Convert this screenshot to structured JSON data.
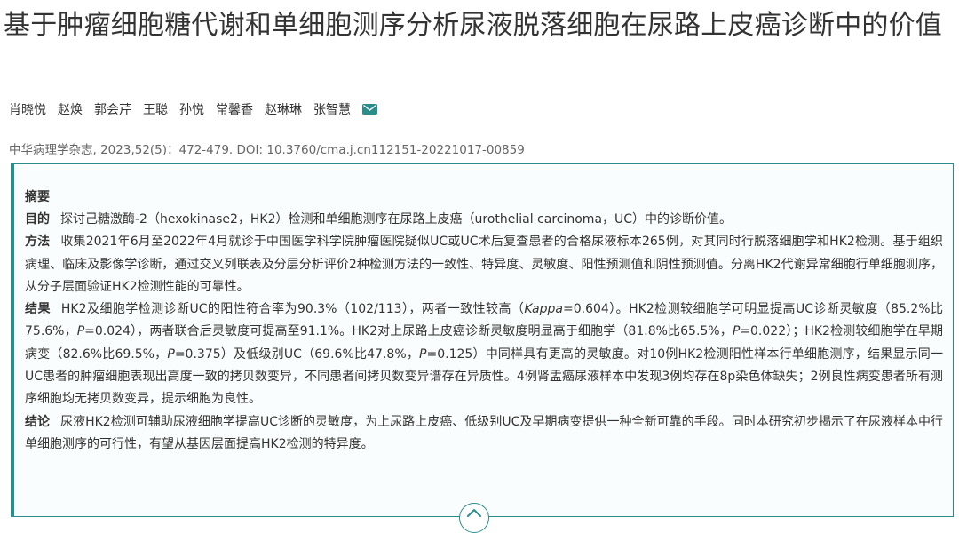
{
  "article": {
    "title": "基于肿瘤细胞糖代谢和单细胞测序分析尿液脱落细胞在尿路上皮癌诊断中的价值",
    "authors": [
      "肖晓悦",
      "赵焕",
      "郭会芹",
      "王聪",
      "孙悦",
      "常馨香",
      "赵琳琳",
      "张智慧"
    ],
    "journal_citation": "中华病理学杂志, 2023,52(5)：472-479. DOI: 10.3760/cma.j.cn112151-20221017-00859"
  },
  "abstract": {
    "heading": "摘要",
    "sections": [
      {
        "label": "目的",
        "parts": [
          {
            "text": "探讨己糖激酶-2（hexokinase2，HK2）检测和单细胞测序在尿路上皮癌（urothelial carcinoma，UC）中的诊断价值。",
            "italic": false
          }
        ]
      },
      {
        "label": "方法",
        "parts": [
          {
            "text": "收集2021年6月至2022年4月就诊于中国医学科学院肿瘤医院疑似UC或UC术后复查患者的合格尿液标本265例，对其同时行脱落细胞学和HK2检测。基于组织病理、临床及影像学诊断，通过交叉列联表及分层分析评价2种检测方法的一致性、特异度、灵敏度、阳性预测值和阴性预测值。分离HK2代谢异常细胞行单细胞测序，从分子层面验证HK2检测性能的可靠性。",
            "italic": false
          }
        ]
      },
      {
        "label": "结果",
        "parts": [
          {
            "text": "HK2及细胞学检测诊断UC的阳性符合率为90.3%（102/113），两者一致性较高（",
            "italic": false
          },
          {
            "text": "Kappa",
            "italic": true
          },
          {
            "text": "=0.604）。HK2检测较细胞学可明显提高UC诊断灵敏度（85.2%比75.6%，",
            "italic": false
          },
          {
            "text": "P",
            "italic": true
          },
          {
            "text": "=0.024），两者联合后灵敏度可提高至91.1%。HK2对上尿路上皮癌诊断灵敏度明显高于细胞学（81.8%比65.5%，",
            "italic": false
          },
          {
            "text": "P",
            "italic": true
          },
          {
            "text": "=0.022）；HK2检测较细胞学在早期病变（82.6%比69.5%，",
            "italic": false
          },
          {
            "text": "P",
            "italic": true
          },
          {
            "text": "=0.375）及低级别UC（69.6%比47.8%，",
            "italic": false
          },
          {
            "text": "P",
            "italic": true
          },
          {
            "text": "=0.125）中同样具有更高的灵敏度。对10例HK2检测阳性样本行单细胞测序，结果显示同一UC患者的肿瘤细胞表现出高度一致的拷贝数变异，不同患者间拷贝数变异谱存在异质性。4例肾盂癌尿液样本中发现3例均存在8p染色体缺失；2例良性病变患者所有测序细胞均无拷贝数变异，提示细胞为良性。",
            "italic": false
          }
        ]
      },
      {
        "label": "结论",
        "parts": [
          {
            "text": "尿液HK2检测可辅助尿液细胞学提高UC诊断的灵敏度，为上尿路上皮癌、低级别UC及早期病变提供一种全新可靠的手段。同时本研究初步揭示了在尿液样本中行单细胞测序的可行性，有望从基因层面提高HK2检测的特异度。",
            "italic": false
          }
        ]
      }
    ]
  },
  "icons": {
    "author_contact": "mail-icon",
    "toggle": "chevron-up-icon"
  },
  "colors": {
    "accent": "#2a8d8c",
    "text": "#333333",
    "muted": "#666666"
  }
}
